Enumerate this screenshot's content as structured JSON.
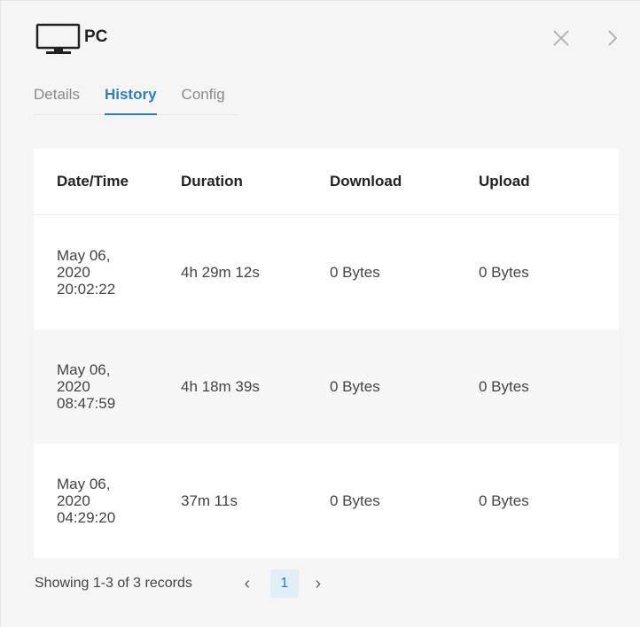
{
  "header": {
    "title": "PC",
    "device_icon": "monitor-icon"
  },
  "tabs": [
    {
      "label": "Details",
      "active": false
    },
    {
      "label": "History",
      "active": true
    },
    {
      "label": "Config",
      "active": false
    }
  ],
  "table": {
    "columns": [
      "Date/Time",
      "Duration",
      "Download",
      "Upload"
    ],
    "rows": [
      {
        "date_line1": "May 06,",
        "date_line2": "2020",
        "date_line3": "20:02:22",
        "duration": "4h 29m 12s",
        "download": "0 Bytes",
        "upload": "0 Bytes"
      },
      {
        "date_line1": "May 06,",
        "date_line2": "2020",
        "date_line3": "08:47:59",
        "duration": "4h 18m 39s",
        "download": "0 Bytes",
        "upload": "0 Bytes"
      },
      {
        "date_line1": "May 06,",
        "date_line2": "2020",
        "date_line3": "04:29:20",
        "duration": "37m 11s",
        "download": "0 Bytes",
        "upload": "0 Bytes"
      }
    ]
  },
  "pagination": {
    "summary": "Showing 1-3 of 3 records",
    "current_page": "1"
  },
  "colors": {
    "accent": "#2a7fc1",
    "page_bg": "#f5f5f5",
    "card_bg": "#ffffff",
    "active_page_bg": "#e1eef7"
  }
}
